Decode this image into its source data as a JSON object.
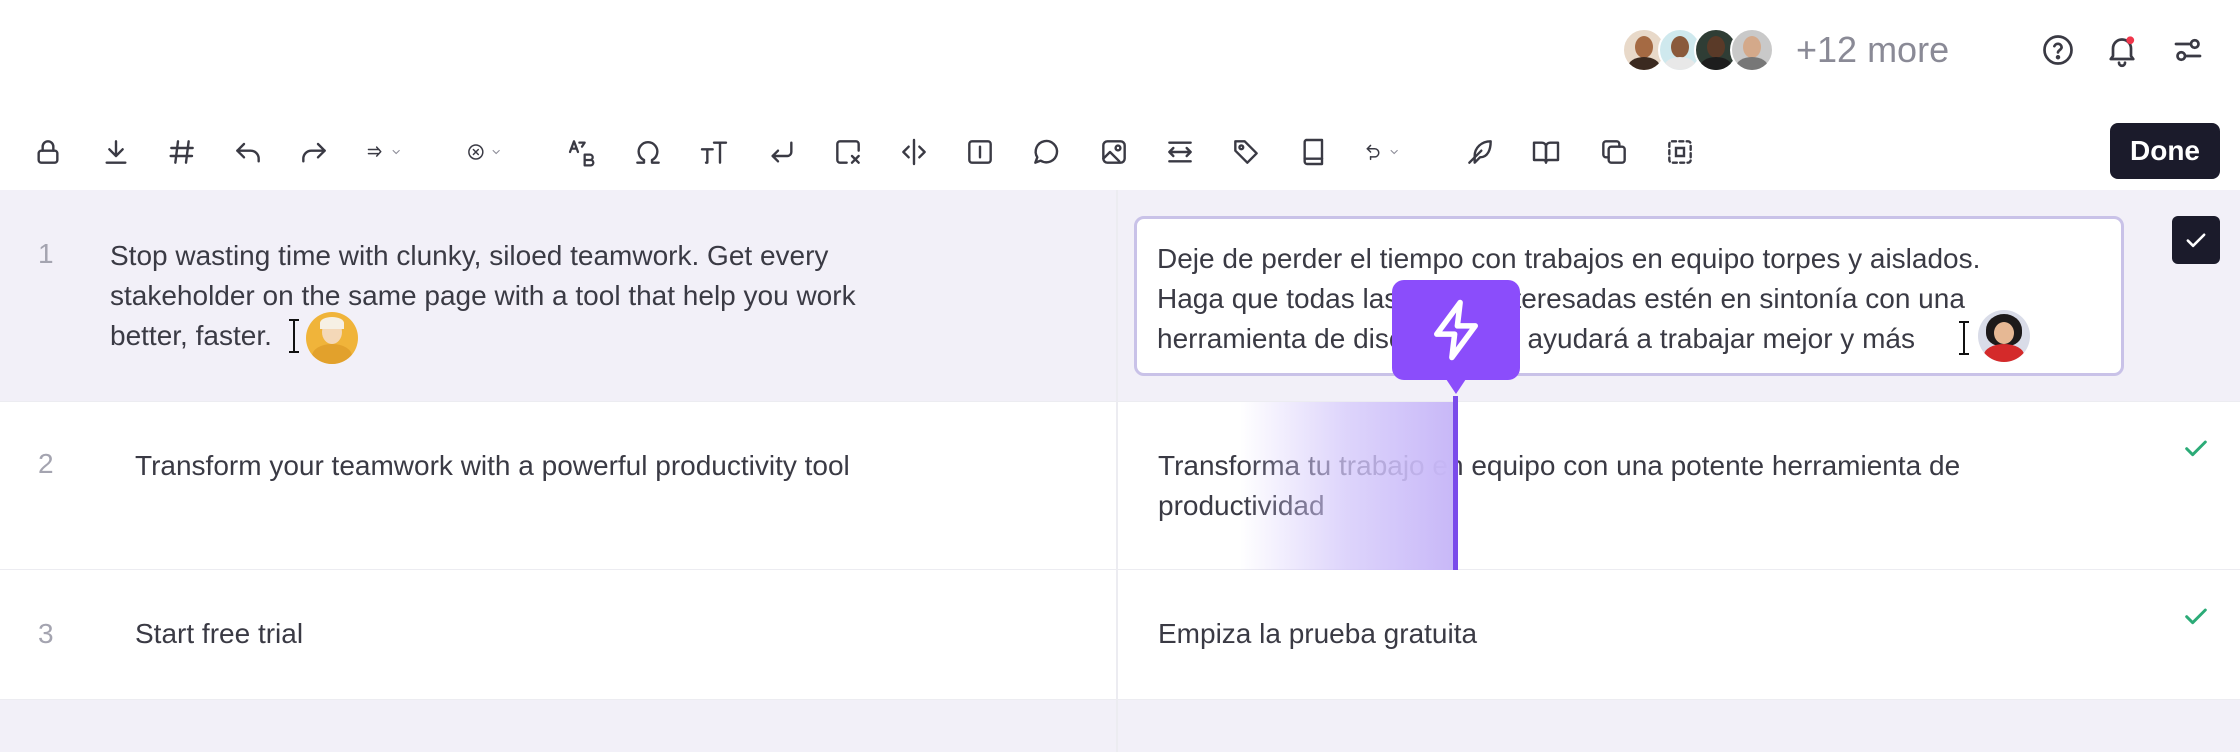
{
  "header": {
    "more_label": "+12 more"
  },
  "toolbar": {
    "done_label": "Done"
  },
  "rows": [
    {
      "num": "1",
      "source_lines": [
        "Stop wasting time with clunky, siloed teamwork. Get every",
        "stakeholder on the same page with a tool that help you work",
        "better, faster."
      ],
      "target_lines": [
        "Deje de perder el tiempo con trabajos en equipo torpes y aislados.",
        "Haga que todas las partes interesadas estén en sintonía con una",
        "herramienta de diseño que le ayudará a trabajar mejor y más"
      ]
    },
    {
      "num": "2",
      "source_lines": [
        "Transform your teamwork with a powerful productivity tool"
      ],
      "target_lines": [
        "Transforma tu trabajo en equipo con una potente herramienta de",
        "productividad"
      ]
    },
    {
      "num": "3",
      "source_lines": [
        "Start free trial"
      ],
      "target_lines": [
        "Empiza la prueba gratuita"
      ]
    }
  ],
  "colors": {
    "accent": "#8b4dfb",
    "done_bg": "#1b1b2b",
    "check_green": "#2bab77",
    "active_row": "#f2f0f8",
    "notification_dot": "#f0364b"
  },
  "icons": {
    "toolbar": [
      "lock-icon",
      "download-icon",
      "hash-icon",
      "undo-icon",
      "redo-icon",
      "arrow-right-dropdown-icon",
      "clear-circle-dropdown-icon",
      "case-icon",
      "omega-icon",
      "text-size-icon",
      "enter-icon",
      "clear-box-icon",
      "split-icon",
      "info-box-icon",
      "comment-icon",
      "image-icon",
      "wrap-icon",
      "tag-icon",
      "book-icon",
      "revert-dropdown-icon",
      "feather-icon",
      "open-book-icon",
      "copy-icon",
      "select-icon"
    ],
    "header": [
      "help-icon",
      "bell-icon",
      "settings-icon"
    ]
  }
}
